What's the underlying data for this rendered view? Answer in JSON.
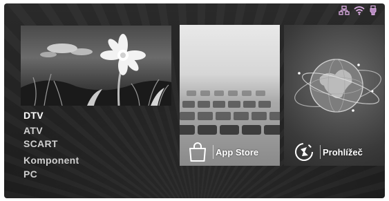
{
  "status_icons": [
    "network-icon",
    "wifi-icon",
    "usb-icon"
  ],
  "source_list": {
    "items": [
      "DTV",
      "ATV",
      "SCART",
      "Komponent",
      "PC"
    ],
    "selected": "DTV"
  },
  "tiles": {
    "app_store": {
      "label": "App Store",
      "icon": "shopping-bag-icon"
    },
    "browser": {
      "label": "Prohlížeč",
      "icon": "browser-compass-icon"
    }
  },
  "colors": {
    "background": "#222222",
    "text": "#ffffff",
    "status_icon_accent": "#e0b0e8"
  }
}
